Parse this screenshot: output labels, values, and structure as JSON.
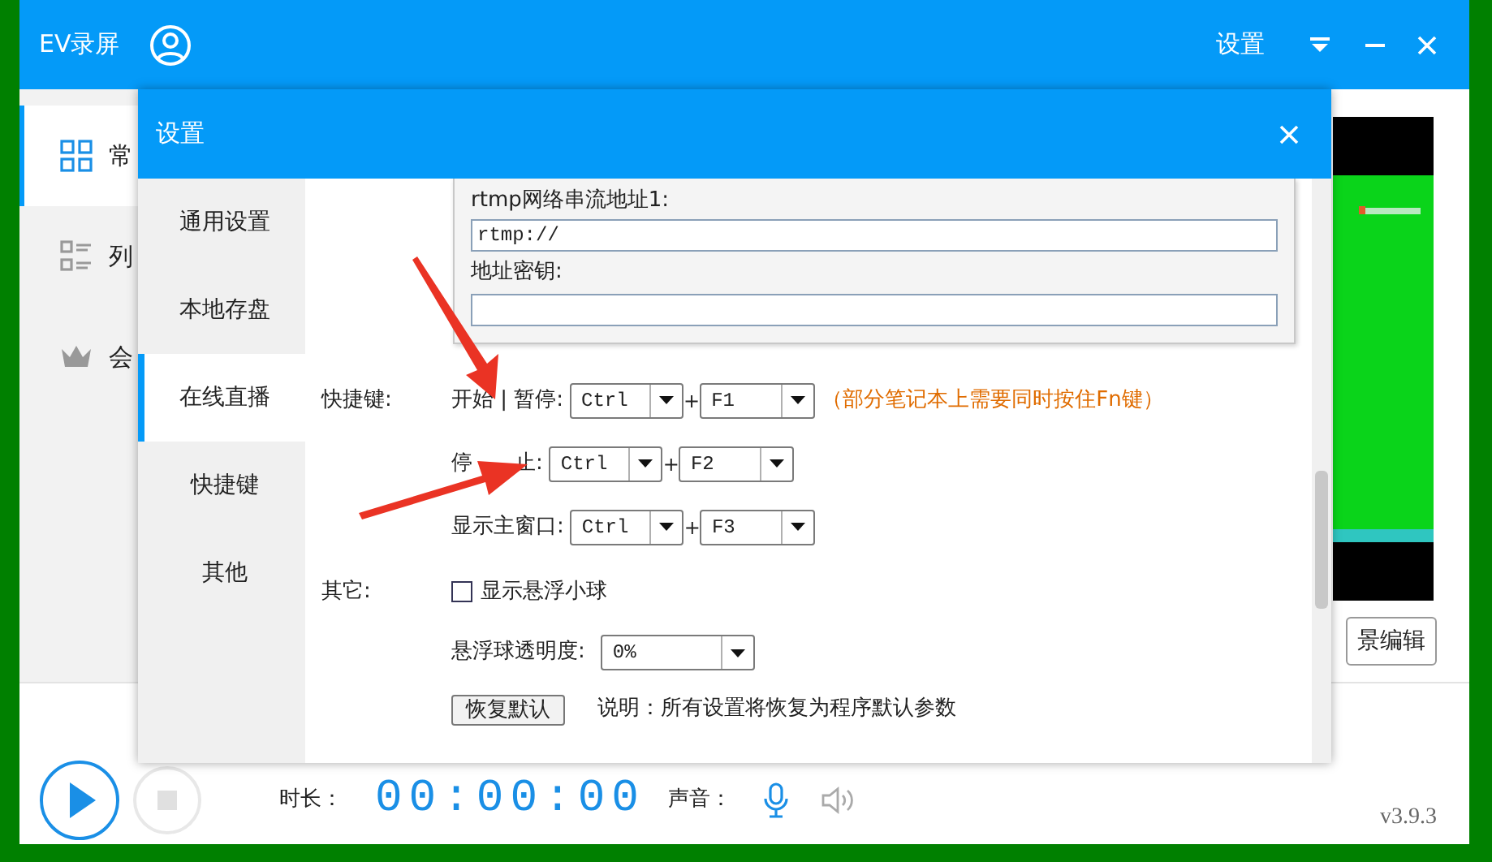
{
  "app": {
    "title": "EV录屏",
    "settings_label": "设置"
  },
  "sidebar": {
    "items": [
      {
        "label": "常",
        "selected": true
      },
      {
        "label": "列",
        "selected": false
      },
      {
        "label": "会",
        "selected": false
      }
    ]
  },
  "preview": {
    "scene_button": "景编辑"
  },
  "bottom": {
    "duration_label": "时长：",
    "clock": "00:00:00",
    "sound_label": "声音：",
    "version": "v3.9.3"
  },
  "dialog": {
    "title": "设置",
    "nav": [
      {
        "label": "通用设置",
        "selected": false
      },
      {
        "label": "本地存盘",
        "selected": false
      },
      {
        "label": "在线直播",
        "selected": true
      },
      {
        "label": "快捷键",
        "selected": false
      },
      {
        "label": "其他",
        "selected": false
      }
    ],
    "stream": {
      "url_label": "rtmp网络串流地址1:",
      "url_value": "rtmp://",
      "key_label": "地址密钥:"
    },
    "hotkeys_label": "快捷键:",
    "hotkeys": [
      {
        "label": "开始 | 暂停:",
        "modifier": "Ctrl",
        "joiner": "+",
        "key": "F1",
        "hint": "（部分笔记本上需要同时按住Fn键）"
      },
      {
        "label": "停　　止:",
        "modifier": "Ctrl",
        "joiner": "+",
        "key": "F2"
      },
      {
        "label": "显示主窗口:",
        "modifier": "Ctrl",
        "joiner": "+",
        "key": "F3"
      }
    ],
    "other_label": "其它:",
    "float_ball": {
      "label": "显示悬浮小球",
      "checked": false
    },
    "opacity": {
      "label": "悬浮球透明度:",
      "value": "0%"
    },
    "reset_button": "恢复默认",
    "reset_note": "说明：所有设置将恢复为程序默认参数"
  }
}
